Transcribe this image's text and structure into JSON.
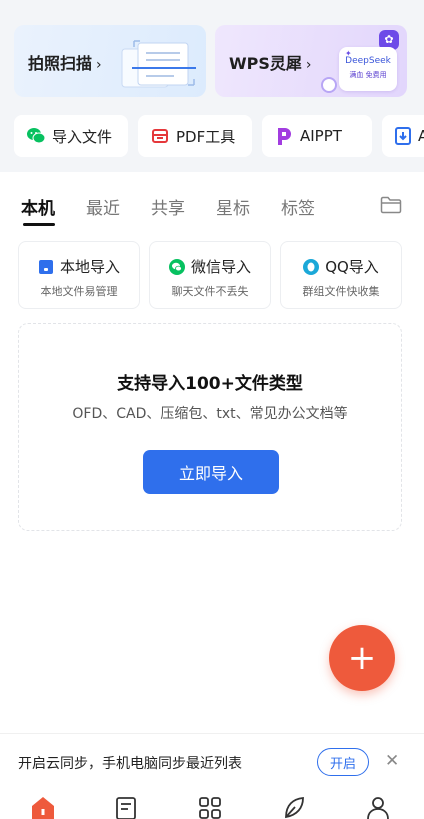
{
  "promos": {
    "scan": {
      "title": "拍照扫描",
      "chevron": "›"
    },
    "ai": {
      "title": "WPS灵犀",
      "chevron": "›",
      "badge_name": "DeepSeek",
      "badge_sub": "满血 免费用",
      "badge_star": "✦"
    }
  },
  "quick_actions": [
    {
      "label": "导入文件",
      "icon": "wechat-icon"
    },
    {
      "label": "PDF工具",
      "icon": "pdf-icon"
    },
    {
      "label": "AIPPT",
      "icon": "aippt-icon"
    },
    {
      "label": "AI",
      "icon": "ai-doc-icon"
    }
  ],
  "tabs": [
    {
      "label": "本机",
      "active": true
    },
    {
      "label": "最近",
      "active": false
    },
    {
      "label": "共享",
      "active": false
    },
    {
      "label": "星标",
      "active": false
    },
    {
      "label": "标签",
      "active": false
    }
  ],
  "import_sources": [
    {
      "title": "本地导入",
      "subtitle": "本地文件易管理",
      "icon": "phone-icon"
    },
    {
      "title": "微信导入",
      "subtitle": "聊天文件不丢失",
      "icon": "wechat-icon"
    },
    {
      "title": "QQ导入",
      "subtitle": "群组文件快收集",
      "icon": "qq-icon"
    }
  ],
  "drop_zone": {
    "title": "支持导入100+文件类型",
    "subtitle": "OFD、CAD、压缩包、txt、常见办公文档等",
    "button": "立即导入"
  },
  "fab": {
    "symbol": "+"
  },
  "sync_banner": {
    "text": "开启云同步，手机电脑同步最近列表",
    "button": "开启",
    "close": "✕"
  },
  "bottom_nav": [
    {
      "icon": "home-icon",
      "active": true
    },
    {
      "icon": "document-icon",
      "active": false
    },
    {
      "icon": "apps-icon",
      "active": false
    },
    {
      "icon": "leaf-icon",
      "active": false
    },
    {
      "icon": "profile-icon",
      "active": false
    }
  ],
  "colors": {
    "primary": "#2f6fec",
    "fab": "#ee5a3c",
    "home_active": "#ee5a3c",
    "wechat": "#07c160",
    "pdf": "#e5383b",
    "aippt": "#a23ce0",
    "qq": "#1ba8d8"
  }
}
